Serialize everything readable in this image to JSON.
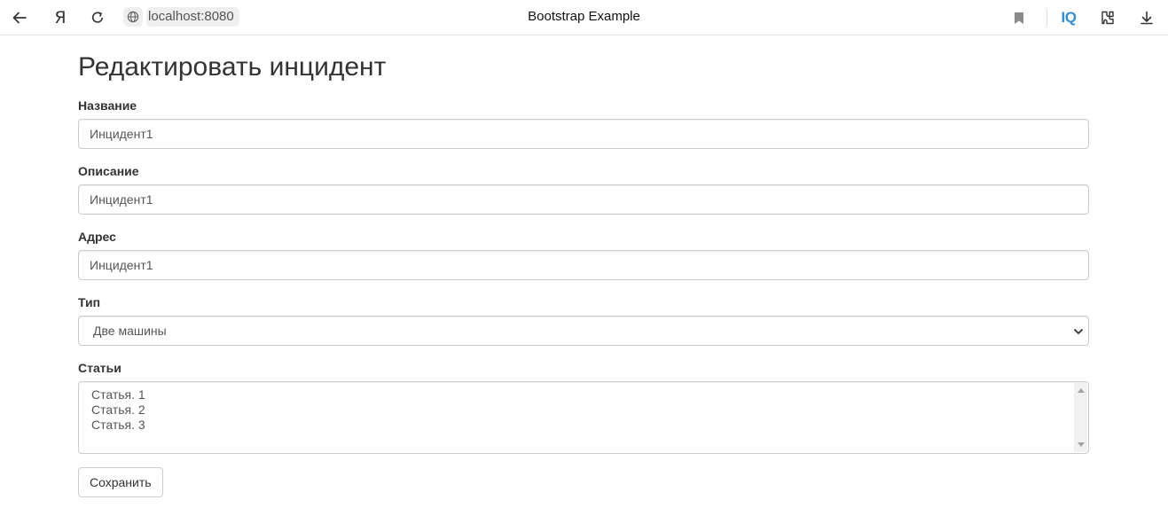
{
  "browser": {
    "yandex_glyph": "Я",
    "url": "localhost:8080",
    "tab_title": "Bootstrap Example",
    "iq_label": "IQ",
    "accent_color": "#2f8fd8"
  },
  "page": {
    "title": "Редактировать инцидент"
  },
  "form": {
    "name": {
      "label": "Название",
      "value": "Инцидент1"
    },
    "description": {
      "label": "Описание",
      "value": "Инцидент1"
    },
    "address": {
      "label": "Адрес",
      "value": "Инцидент1"
    },
    "type": {
      "label": "Тип",
      "selected": "Две машины"
    },
    "articles": {
      "label": "Статьи",
      "options": [
        "Статья. 1",
        "Статья. 2",
        "Статья. 3"
      ]
    },
    "save_label": "Сохранить"
  }
}
